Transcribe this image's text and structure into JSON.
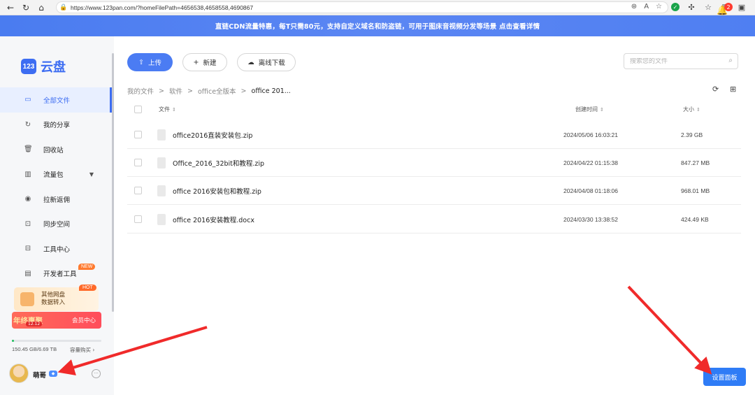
{
  "browser": {
    "url": "https://www.123pan.com/?homeFilePath=4656538,4658558,4690867"
  },
  "banner": {
    "text": "直链CDN流量特惠，每T只需80元，支持自定义域名和防盗链，可用于图床音视频分发等场景 点击查看详情",
    "notification_count": "2"
  },
  "logo": {
    "mark": "123",
    "text": "云盘"
  },
  "sidebar": {
    "items": [
      {
        "label": "全部文件",
        "icon": "folder-icon"
      },
      {
        "label": "我的分享",
        "icon": "share-icon"
      },
      {
        "label": "回收站",
        "icon": "trash-icon"
      },
      {
        "label": "流量包",
        "icon": "traffic-icon"
      },
      {
        "label": "拉新返佣",
        "icon": "coin-icon"
      },
      {
        "label": "同步空间",
        "icon": "sync-icon"
      },
      {
        "label": "工具中心",
        "icon": "toolbox-icon"
      },
      {
        "label": "开发者工具",
        "icon": "terminal-icon",
        "badge": "NEW"
      }
    ],
    "promo": {
      "line1": "其他网盘",
      "line2": "数据转入",
      "badge": "HOT"
    },
    "vip_promo": {
      "left": "年终惠聚",
      "date": "12.12",
      "right": "会员中心"
    },
    "storage": {
      "used_fraction": 0.022,
      "text": "150.45 GB/6.69 TB",
      "buy": "容量购买"
    },
    "user": {
      "name": "萌哥"
    }
  },
  "toolbar": {
    "upload": "上传",
    "new": "新建",
    "offline": "离线下载",
    "search_placeholder": "搜索您的文件"
  },
  "breadcrumb": [
    "我的文件",
    "软件",
    "office全版本",
    "office 201..."
  ],
  "table": {
    "headers": {
      "name": "文件",
      "created": "创建时间",
      "size": "大小"
    },
    "rows": [
      {
        "name": "office2016直装安装包.zip",
        "created": "2024/05/06 16:03:21",
        "size": "2.39 GB"
      },
      {
        "name": "Office_2016_32bit和教程.zip",
        "created": "2024/04/22 01:15:38",
        "size": "847.27 MB"
      },
      {
        "name": "office 2016安装包和教程.zip",
        "created": "2024/04/08 01:18:06",
        "size": "968.01 MB"
      },
      {
        "name": "office 2016安装教程.docx",
        "created": "2024/03/30 13:38:52",
        "size": "424.49 KB"
      }
    ]
  },
  "settings_button": "设置面板",
  "colors": {
    "accent": "#3d6df2",
    "banner": "#4f7ff2",
    "arrow": "#f02a2a"
  }
}
